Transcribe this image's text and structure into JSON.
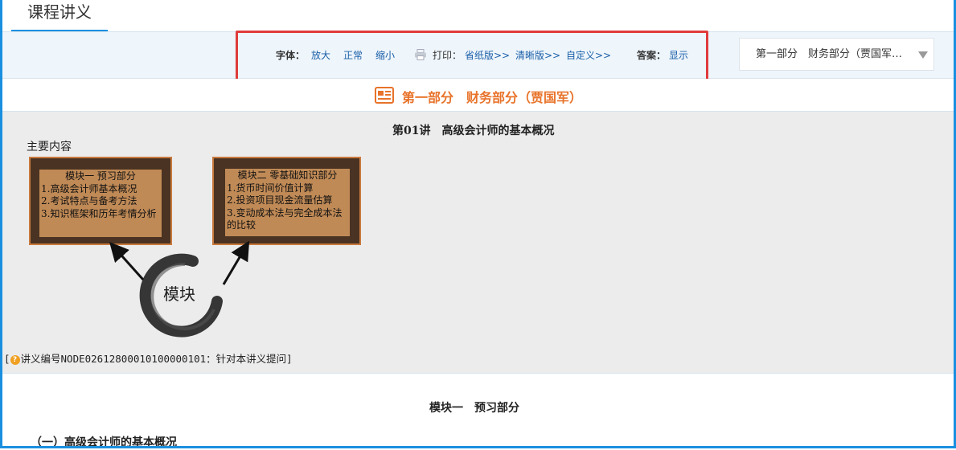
{
  "header": {
    "title": "课程讲义"
  },
  "toolbar": {
    "font_label": "字体：",
    "font_enlarge": "放大",
    "font_normal": "正常",
    "font_shrink": "缩小",
    "print_label": "打印：",
    "print_economy": "省纸版>>",
    "print_clear": "清晰版>>",
    "print_custom": "自定义>>",
    "answer_label": "答案：",
    "answer_show": "显示"
  },
  "part_selector": {
    "selected": "第一部分　财务部分（贾国军…"
  },
  "section": {
    "title": "第一部分　财务部分（贾国军）"
  },
  "lecture": {
    "title": "第01讲　高级会计师的基本概况",
    "main_label": "主要内容",
    "module1": {
      "head": "模块一 预习部分",
      "items": [
        "1.高级会计师基本概况",
        "2.考试特点与备考方法",
        "3.知识框架和历年考情分析"
      ]
    },
    "module2": {
      "head": "模块二 零基础知识部分",
      "items": [
        "1.货币时间价值计算",
        "2.投资项目现金流量估算",
        "3.变动成本法与完全成本法的比较"
      ]
    },
    "center_label": "模块",
    "footnote_open": "[",
    "footnote": "讲义编号NODE02612800010100000101：针对本讲义提问]"
  },
  "body": {
    "module1_title": "模块一　预习部分",
    "subsection": "（一）高级会计师的基本概况"
  },
  "colors": {
    "accent": "#1a8fe0",
    "section_orange": "#e8732a",
    "highlight_red": "#e03b3b",
    "link": "#1a5fa8"
  }
}
